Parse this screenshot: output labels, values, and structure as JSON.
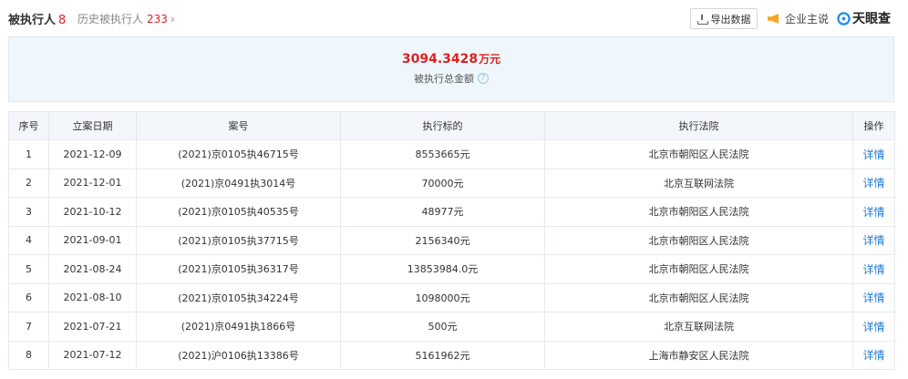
{
  "header": {
    "title": "被执行人",
    "count": "8",
    "history_label": "历史被执行人",
    "history_count": "233",
    "history_chevron": "›",
    "export_label": "导出数据",
    "enterprise_label": "企业主说",
    "logo_text": "天眼查"
  },
  "summary": {
    "amount": "3094.3428",
    "unit": "万元",
    "label": "被执行总金额",
    "help": "?"
  },
  "table": {
    "headers": [
      "序号",
      "立案日期",
      "案号",
      "执行标的",
      "执行法院",
      "操作"
    ],
    "rows": [
      {
        "index": "1",
        "date": "2021-12-09",
        "case_no": "(2021)京0105执46715号",
        "target": "8553665元",
        "court": "北京市朝阳区人民法院",
        "action": "详情"
      },
      {
        "index": "2",
        "date": "2021-12-01",
        "case_no": "(2021)京0491执3014号",
        "target": "70000元",
        "court": "北京互联网法院",
        "action": "详情"
      },
      {
        "index": "3",
        "date": "2021-10-12",
        "case_no": "(2021)京0105执40535号",
        "target": "48977元",
        "court": "北京市朝阳区人民法院",
        "action": "详情"
      },
      {
        "index": "4",
        "date": "2021-09-01",
        "case_no": "(2021)京0105执37715号",
        "target": "2156340元",
        "court": "北京市朝阳区人民法院",
        "action": "详情"
      },
      {
        "index": "5",
        "date": "2021-08-24",
        "case_no": "(2021)京0105执36317号",
        "target": "13853984.0元",
        "court": "北京市朝阳区人民法院",
        "action": "详情"
      },
      {
        "index": "6",
        "date": "2021-08-10",
        "case_no": "(2021)京0105执34224号",
        "target": "1098000元",
        "court": "北京市朝阳区人民法院",
        "action": "详情"
      },
      {
        "index": "7",
        "date": "2021-07-21",
        "case_no": "(2021)京0491执1866号",
        "target": "500元",
        "court": "北京互联网法院",
        "action": "详情"
      },
      {
        "index": "8",
        "date": "2021-07-12",
        "case_no": "(2021)沪0106执13386号",
        "target": "5161962元",
        "court": "上海市静安区人民法院",
        "action": "详情"
      }
    ]
  }
}
